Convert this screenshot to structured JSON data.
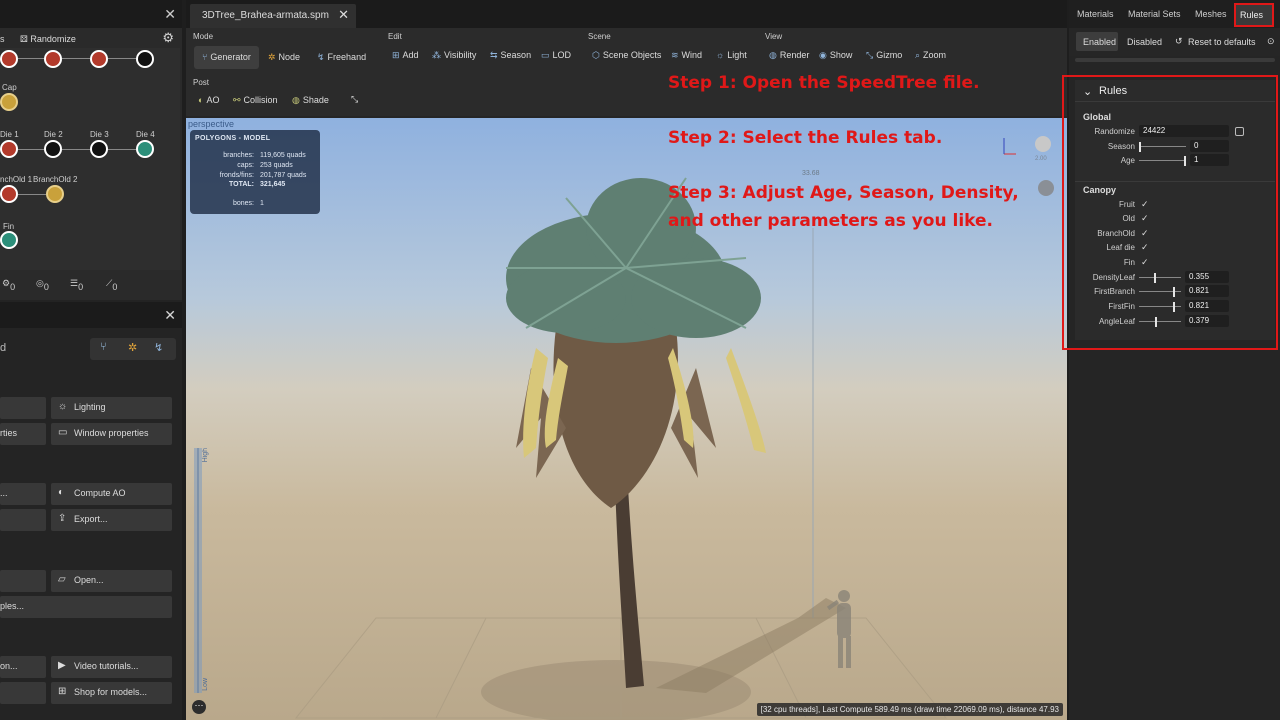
{
  "left_top": {
    "toolbar_prefix": "s",
    "randomize": "Randomize",
    "nodes": [
      {
        "label": "Cap"
      },
      {
        "label": "Die 1"
      },
      {
        "label": "Die 2"
      },
      {
        "label": "Die 3"
      },
      {
        "label": "Die 4"
      },
      {
        "label": "nchOld 1"
      },
      {
        "label": "BranchOld 2"
      },
      {
        "label": "Fin"
      }
    ],
    "counts": [
      "0",
      "0",
      "0",
      "0"
    ]
  },
  "left_bottom": {
    "head_text": "d",
    "buttons": [
      {
        "label": "Lighting"
      },
      {
        "label": "rties"
      },
      {
        "label": "Window properties"
      },
      {
        "label": "..."
      },
      {
        "label": "Compute AO"
      },
      {
        "label": "Export..."
      },
      {
        "label": "Open..."
      },
      {
        "label": "ples..."
      },
      {
        "label": "on..."
      },
      {
        "label": "Video tutorials..."
      },
      {
        "label": "Shop for models..."
      }
    ]
  },
  "file_tab": {
    "title": "3DTree_Brahea-armata.spm"
  },
  "ribbon": {
    "mode": {
      "title": "Mode",
      "items": [
        "Generator",
        "Node",
        "Freehand"
      ]
    },
    "edit": {
      "title": "Edit",
      "items": [
        "Add",
        "Visibility",
        "Season",
        "LOD"
      ]
    },
    "scene": {
      "title": "Scene",
      "items": [
        "Scene Objects",
        "Wind",
        "Light"
      ]
    },
    "view": {
      "title": "View",
      "items": [
        "Render",
        "Show",
        "Gizmo",
        "Zoom"
      ]
    },
    "post": {
      "title": "Post",
      "items": [
        "AO",
        "Collision",
        "Shade"
      ]
    }
  },
  "viewport": {
    "label": "perspective",
    "poly_title": "POLYGONS - MODEL",
    "poly_rows": [
      {
        "k": "branches:",
        "v": "119,605 quads"
      },
      {
        "k": "caps:",
        "v": "253 quads"
      },
      {
        "k": "fronds/fins:",
        "v": "201,787 quads"
      },
      {
        "k": "TOTAL:",
        "v": "321,645"
      },
      {
        "k": "bones:",
        "v": "1"
      }
    ],
    "scale_top": "High",
    "scale_bottom": "Low",
    "measure": "33.68",
    "gizmo_value": "2.00",
    "status": "[32 cpu threads], Last Compute 589.49 ms (draw time 22069.09 ms), distance 47.93"
  },
  "annotations": {
    "step1": "Step 1: Open the SpeedTree file.",
    "step2": "Step 2: Select the Rules tab.",
    "step3_line1": "Step 3: Adjust Age, Season, Density,",
    "step3_line2": "and other parameters as you like."
  },
  "right": {
    "tabs": [
      "Materials",
      "Material Sets",
      "Meshes",
      "Rules"
    ],
    "enabled": "Enabled",
    "disabled": "Disabled",
    "reset": "Reset to defaults",
    "panel_title": "Rules",
    "global_title": "Global",
    "randomize_label": "Randomize",
    "randomize_value": "24422",
    "season_label": "Season",
    "season_value": "0",
    "age_label": "Age",
    "age_value": "1",
    "canopy_title": "Canopy",
    "checks": [
      "Fruit",
      "Old",
      "BranchOld",
      "Leaf die",
      "Fin"
    ],
    "density_label": "DensityLeaf",
    "density_value": "0.355",
    "firstbranch_label": "FirstBranch",
    "firstbranch_value": "0.821",
    "firstfin_label": "FirstFin",
    "firstfin_value": "0.821",
    "angleleaf_label": "AngleLeaf",
    "angleleaf_value": "0.379"
  },
  "colors": {
    "annotation_red": "#e01818",
    "accent_blue": "#8fb3d9"
  }
}
